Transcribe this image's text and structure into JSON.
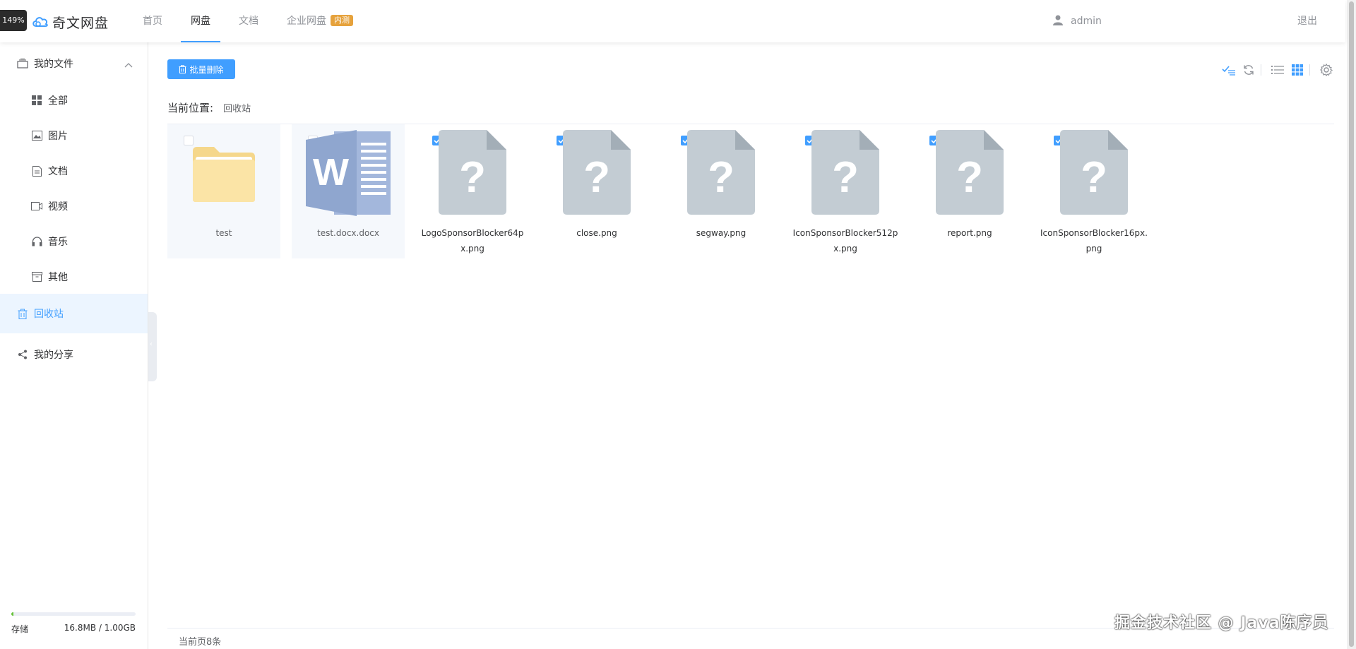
{
  "zoom": "149%",
  "header": {
    "logo_text": "奇文网盘",
    "nav": [
      {
        "label": "首页",
        "active": false
      },
      {
        "label": "网盘",
        "active": true
      },
      {
        "label": "文档",
        "active": false
      },
      {
        "label": "企业网盘",
        "tag": "内测",
        "active": false
      }
    ],
    "username": "admin",
    "logout": "退出"
  },
  "sidebar": {
    "my_files": "我的文件",
    "categories": [
      {
        "label": "全部",
        "icon": "grid-icon"
      },
      {
        "label": "图片",
        "icon": "image-icon"
      },
      {
        "label": "文档",
        "icon": "document-icon"
      },
      {
        "label": "视频",
        "icon": "video-icon"
      },
      {
        "label": "音乐",
        "icon": "headphones-icon"
      },
      {
        "label": "其他",
        "icon": "archive-icon"
      }
    ],
    "recycle": "回收站",
    "share": "我的分享",
    "storage_label": "存储",
    "storage_value": "16.8MB / 1.00GB",
    "storage_fraction": 0.016
  },
  "main": {
    "batch_delete": "批量删除",
    "breadcrumb_label": "当前位置:",
    "breadcrumb_current": "回收站",
    "files": [
      {
        "name": "test",
        "type": "folder",
        "checked": false
      },
      {
        "name": "test.docx.docx",
        "type": "word",
        "checked": false
      },
      {
        "name": "LogoSponsorBlocker64px.png",
        "type": "unknown",
        "checked": true
      },
      {
        "name": "close.png",
        "type": "unknown",
        "checked": true
      },
      {
        "name": "segway.png",
        "type": "unknown",
        "checked": true
      },
      {
        "name": "IconSponsorBlocker512px.png",
        "type": "unknown",
        "checked": true
      },
      {
        "name": "report.png",
        "type": "unknown",
        "checked": true
      },
      {
        "name": "IconSponsorBlocker16px.png",
        "type": "unknown",
        "checked": true
      }
    ],
    "footer": "当前页8条"
  },
  "watermark": "掘金技术社区 @ Java陈序员",
  "colors": {
    "primary": "#409eff",
    "tag": "#e6a23c",
    "storage": "#67c23a",
    "folder": "#fbe4a6",
    "word": "#8fa6cf",
    "unknown": "#c3ccd3"
  }
}
